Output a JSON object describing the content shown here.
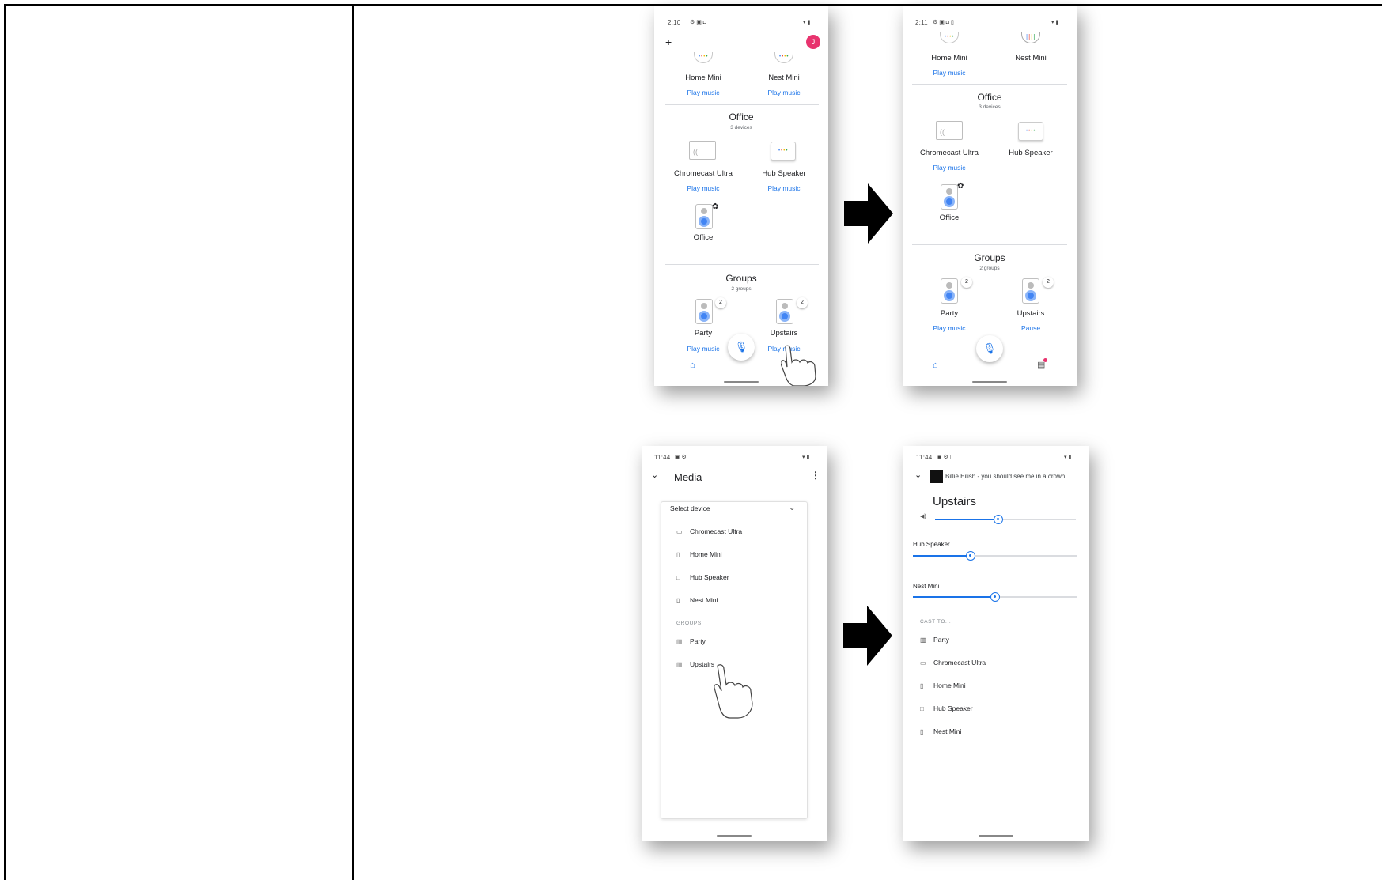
{
  "screen1": {
    "time": "2:10",
    "plus": "+",
    "avatar": "J",
    "home_mini": "Home Mini",
    "nest_mini": "Nest Mini",
    "play_music": "Play music",
    "office_title": "Office",
    "office_count": "3 devices",
    "chromecast": "Chromecast Ultra",
    "hub_speaker": "Hub Speaker",
    "office_device": "Office",
    "groups_title": "Groups",
    "groups_count": "2 groups",
    "party": "Party",
    "upstairs": "Upstairs",
    "badge": "2"
  },
  "screen2": {
    "time": "2:11",
    "home_mini": "Home Mini",
    "nest_mini": "Nest Mini",
    "play_music": "Play music",
    "office_title": "Office",
    "office_count": "3 devices",
    "chromecast": "Chromecast Ultra",
    "hub_speaker": "Hub Speaker",
    "office_device": "Office",
    "groups_title": "Groups",
    "groups_count": "2 groups",
    "party": "Party",
    "upstairs": "Upstairs",
    "pause": "Pause",
    "badge": "2"
  },
  "screen3": {
    "time": "11:44",
    "title": "Media",
    "select_device": "Select device",
    "devices": [
      "Chromecast Ultra",
      "Home Mini",
      "Hub Speaker",
      "Nest Mini"
    ],
    "groups_header": "GROUPS",
    "groups": [
      "Party",
      "Upstairs"
    ]
  },
  "screen4": {
    "time": "11:44",
    "now_playing": "Billie Eilish - you should see me in a crown",
    "title": "Upstairs",
    "hub_speaker": "Hub Speaker",
    "nest_mini": "Nest Mini",
    "cast_to": "CAST TO...",
    "cast_items": [
      "Party",
      "Chromecast Ultra",
      "Home Mini",
      "Hub Speaker",
      "Nest Mini"
    ],
    "volumes": {
      "group": 0.45,
      "hub_speaker": 0.35,
      "nest_mini": 0.5
    }
  },
  "colors": {
    "link": "#1a73e8",
    "avatar": "#e8336e",
    "slider": "#1a73e8"
  },
  "icons": [
    "plus-icon",
    "home-icon",
    "mic-icon",
    "chevron-down-icon",
    "more-vert-icon",
    "arrow-right-icon",
    "pointing-hand-icon",
    "volume-icon"
  ]
}
